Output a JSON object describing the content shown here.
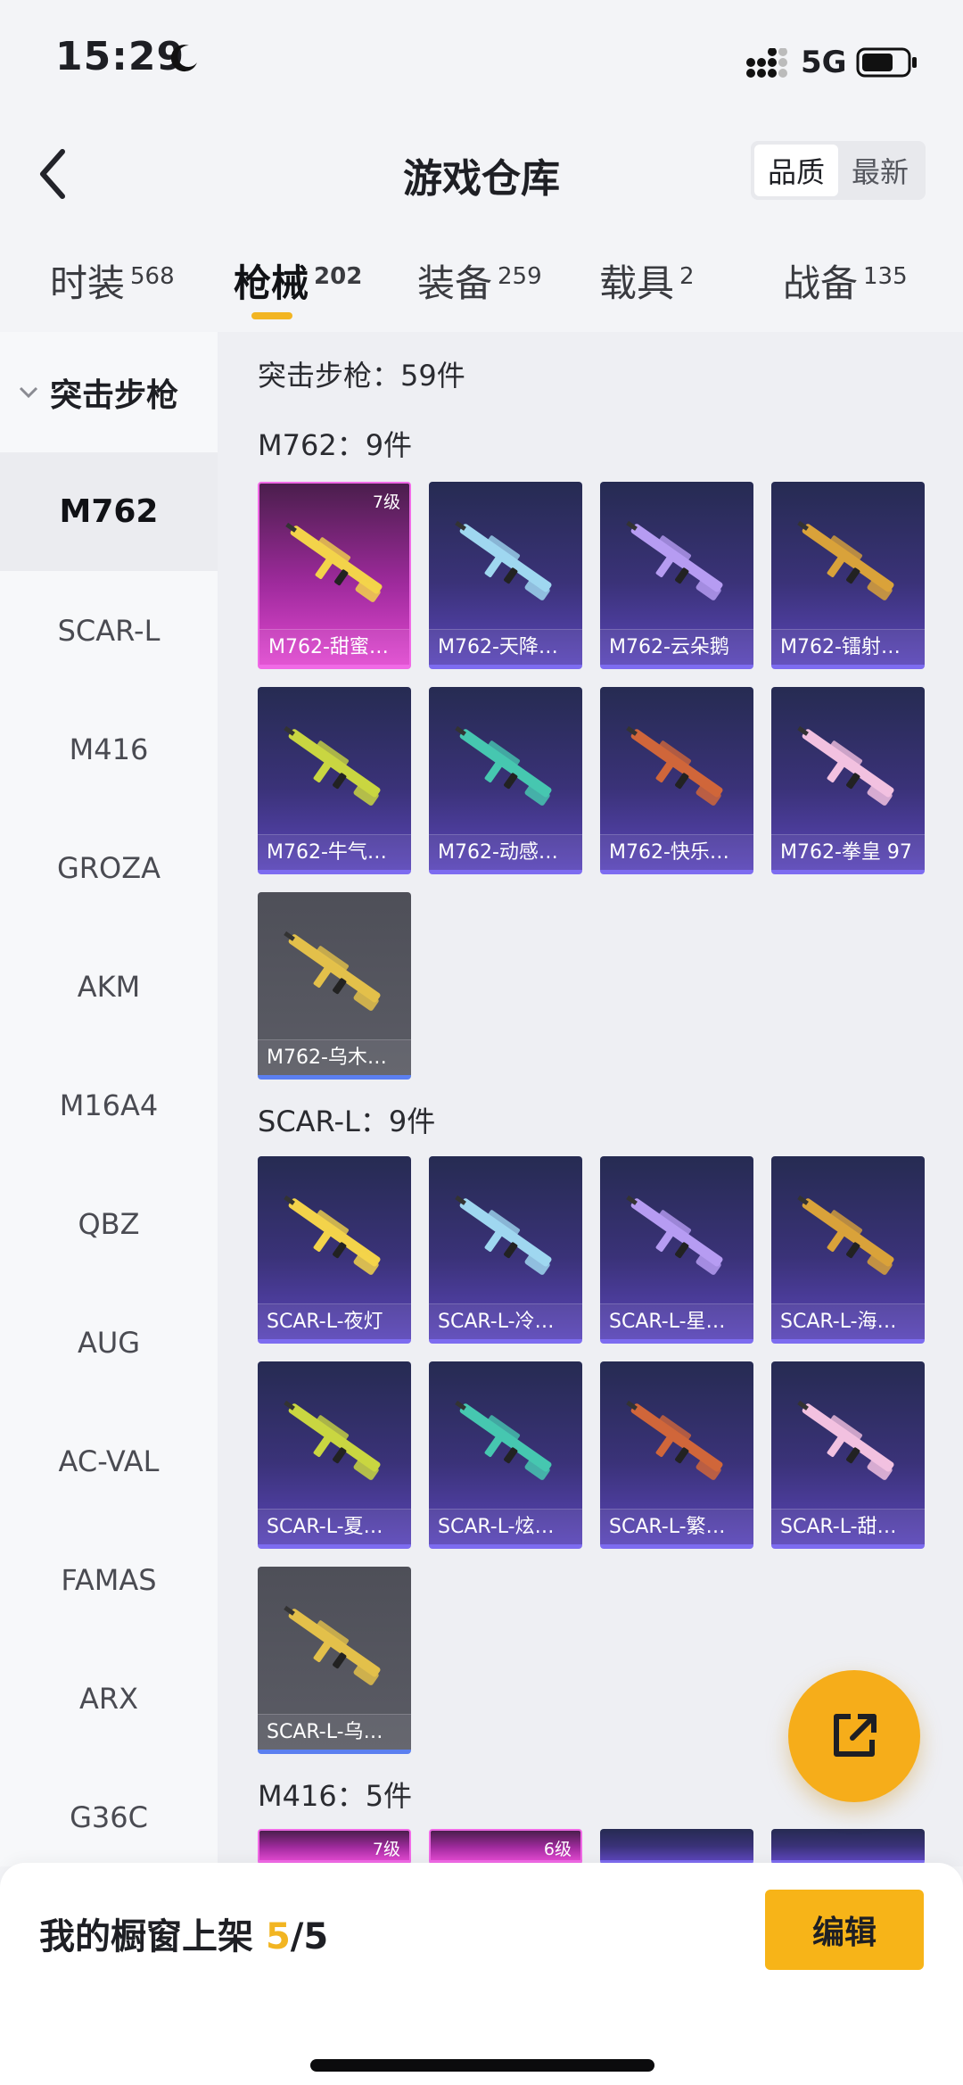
{
  "status_bar": {
    "time": "15:29",
    "network": "5G"
  },
  "header": {
    "title": "游戏仓库",
    "sort_options": [
      "品质",
      "最新"
    ]
  },
  "tabs": [
    {
      "label": "时装",
      "count": "568"
    },
    {
      "label": "枪械",
      "count": "202"
    },
    {
      "label": "装备",
      "count": "259"
    },
    {
      "label": "载具",
      "count": "2"
    },
    {
      "label": "战备",
      "count": "135"
    }
  ],
  "sidebar": {
    "group": "突击步枪",
    "items": [
      "M762",
      "SCAR-L",
      "M416",
      "GROZA",
      "AKM",
      "M16A4",
      "QBZ",
      "AUG",
      "AC-VAL",
      "FAMAS",
      "ARX",
      "G36C"
    ]
  },
  "content": {
    "section_count": "突击步枪：59件",
    "groups": [
      {
        "title": "M762：9件"
      },
      {
        "title": "SCAR-L：9件"
      },
      {
        "title": "M416：5件"
      }
    ],
    "m762_cards": [
      {
        "name": "M762-甜蜜…",
        "level": "7级",
        "color": "#e048d0"
      },
      {
        "name": "M762-天降…"
      },
      {
        "name": "M762-云朵鹅"
      },
      {
        "name": "M762-镭射…"
      },
      {
        "name": "M762-牛气…"
      },
      {
        "name": "M762-动感…"
      },
      {
        "name": "M762-快乐…"
      },
      {
        "name": "M762-拳皇 97"
      },
      {
        "name": "M762-乌木…"
      }
    ],
    "scar_cards": [
      {
        "name": "SCAR-L-夜灯"
      },
      {
        "name": "SCAR-L-冷…"
      },
      {
        "name": "SCAR-L-星…"
      },
      {
        "name": "SCAR-L-海…"
      },
      {
        "name": "SCAR-L-夏…"
      },
      {
        "name": "SCAR-L-炫…"
      },
      {
        "name": "SCAR-L-繁…"
      },
      {
        "name": "SCAR-L-甜…"
      },
      {
        "name": "SCAR-L-乌…"
      }
    ],
    "m416_cards": [
      {
        "level": "7级"
      },
      {
        "level": "6级"
      },
      {
        "level": ""
      },
      {
        "level": ""
      }
    ]
  },
  "bottom_bar": {
    "label": "我的橱窗上架 ",
    "current": "5",
    "total": "/5",
    "edit_label": "编辑"
  },
  "colors": {
    "accent": "#f6ad1a",
    "card_epic": "#5a45b8",
    "card_legend": "#e048d0"
  }
}
